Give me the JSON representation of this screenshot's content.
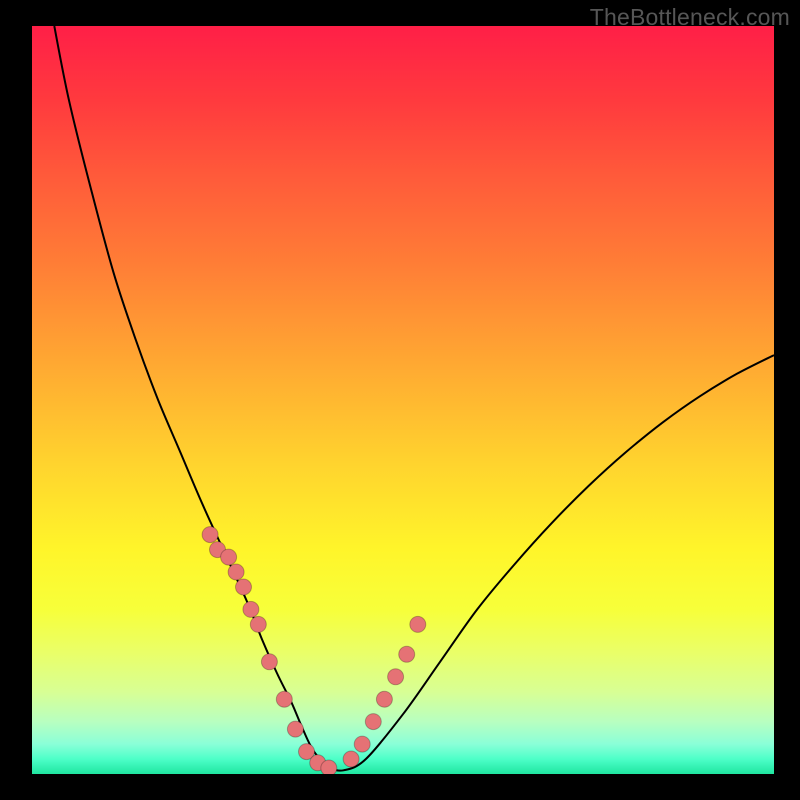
{
  "watermark": "TheBottleneck.com",
  "colors": {
    "background": "#000000",
    "gradient_top": "#ff1f47",
    "gradient_bottom": "#1fe6a0",
    "curve": "#000000",
    "dot_fill": "#e57275"
  },
  "chart_data": {
    "type": "line",
    "title": "",
    "xlabel": "",
    "ylabel": "",
    "xlim": [
      0,
      100
    ],
    "ylim": [
      0,
      100
    ],
    "series": [
      {
        "name": "bottleneck-curve",
        "x": [
          3,
          5,
          8,
          11,
          14,
          17,
          20,
          23,
          26,
          29,
          31,
          33,
          35,
          36.5,
          38,
          40,
          42,
          45,
          50,
          55,
          60,
          65,
          70,
          75,
          80,
          85,
          90,
          95,
          100
        ],
        "y": [
          100,
          90,
          78,
          67,
          58,
          50,
          43,
          36,
          29.5,
          23,
          18,
          13.5,
          9.5,
          6,
          3,
          1,
          0.5,
          2,
          8,
          15,
          22,
          28,
          33.5,
          38.5,
          43,
          47,
          50.5,
          53.5,
          56
        ]
      }
    ],
    "scatter_points": {
      "name": "highlight-dots",
      "x": [
        24,
        25,
        26.5,
        27.5,
        28.5,
        29.5,
        30.5,
        32,
        34,
        35.5,
        37,
        38.5,
        40,
        43,
        44.5,
        46,
        47.5,
        49,
        50.5,
        52
      ],
      "y": [
        32,
        30,
        29,
        27,
        25,
        22,
        20,
        15,
        10,
        6,
        3,
        1.5,
        0.8,
        2,
        4,
        7,
        10,
        13,
        16,
        20
      ]
    },
    "annotations": [
      {
        "text": "TheBottleneck.com",
        "position": "top-right"
      }
    ]
  }
}
